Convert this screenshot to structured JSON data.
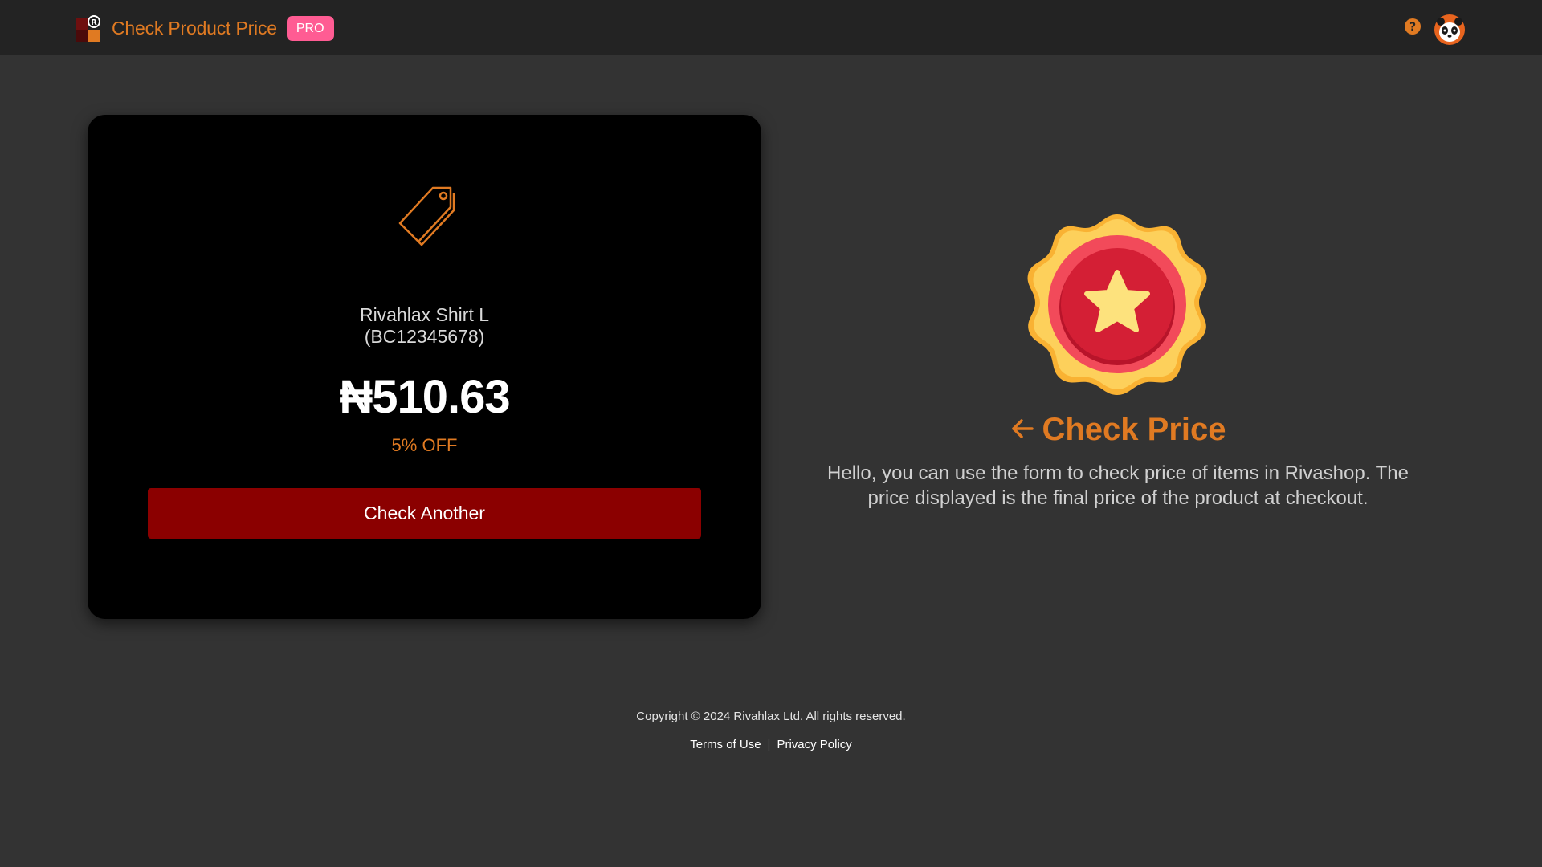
{
  "header": {
    "title": "Check Product Price",
    "badge": "PRO",
    "help_icon": "question-circle-icon",
    "avatar_icon": "panda-avatar-icon"
  },
  "product_card": {
    "icon": "price-tag-icon",
    "name": "Rivahlax Shirt L",
    "code": "(BC12345678)",
    "price": "₦510.63",
    "discount": "5% OFF",
    "button_label": "Check Another"
  },
  "info": {
    "icon": "star-medal-icon",
    "title": "Check Price",
    "description": "Hello, you can use the form to check price of items in Rivashop. The price displayed is the final price of the product at checkout."
  },
  "footer": {
    "copyright": "Copyright © 2024 Rivahlax Ltd. All rights reserved.",
    "links": [
      "Terms of Use",
      "Privacy Policy"
    ],
    "separator": "|"
  },
  "colors": {
    "accent": "#e07a22",
    "badge": "#ff5c93",
    "button": "#8b0000",
    "background": "#333333",
    "card": "#000000"
  }
}
